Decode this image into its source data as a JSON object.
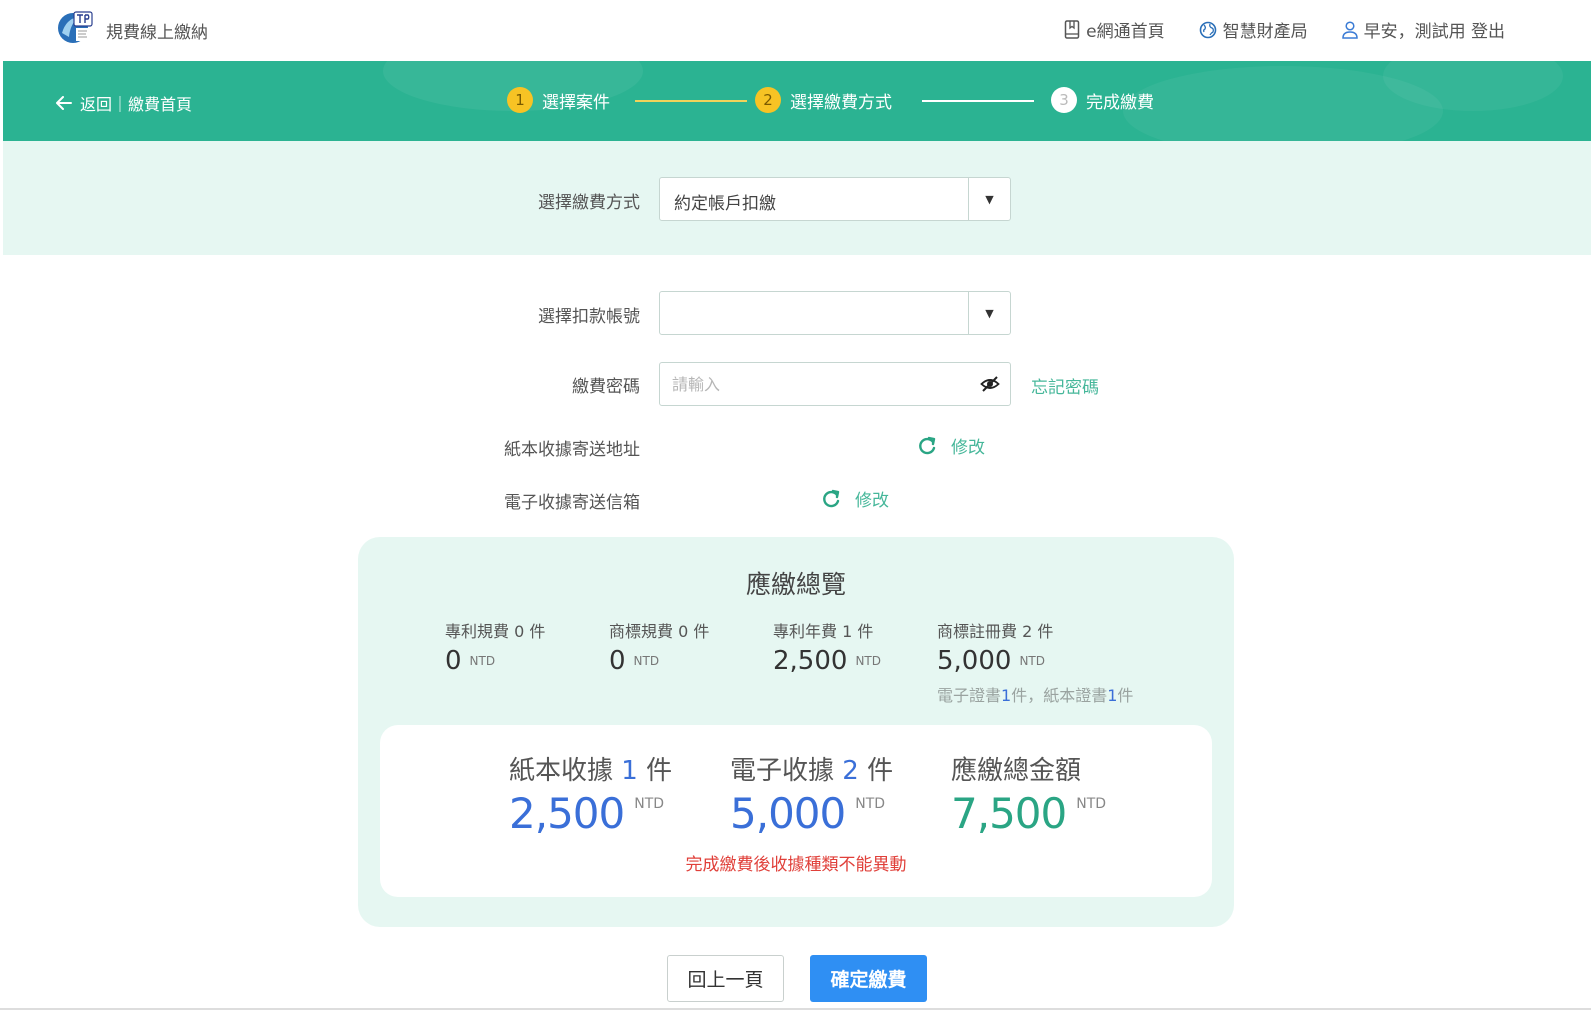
{
  "header": {
    "site_title": "規費線上繳納",
    "nav": [
      {
        "label": "e網通首頁",
        "icon": "book-icon"
      },
      {
        "label": "智慧財產局",
        "icon": "globe-icon"
      },
      {
        "label": "早安，測試用 登出",
        "icon": "user-icon"
      }
    ]
  },
  "stepper": {
    "back_label": "返回｜繳費首頁",
    "steps": [
      {
        "num": "1",
        "label": "選擇案件",
        "state": "done"
      },
      {
        "num": "2",
        "label": "選擇繳費方式",
        "state": "current"
      },
      {
        "num": "3",
        "label": "完成繳費",
        "state": "pending"
      }
    ]
  },
  "form": {
    "method_label": "選擇繳費方式",
    "method_value": "約定帳戶扣繳",
    "account_label": "選擇扣款帳號",
    "account_value": "",
    "password_label": "繳費密碼",
    "password_placeholder": "請輸入",
    "forgot_password": "忘記密碼",
    "paper_address_label": "紙本收據寄送地址",
    "email_label": "電子收據寄送信箱",
    "edit_label": "修改"
  },
  "summary": {
    "title": "應繳總覽",
    "fees": [
      {
        "caption": "專利規費 0 件",
        "amount": "0",
        "unit": "NTD"
      },
      {
        "caption": "商標規費 0 件",
        "amount": "0",
        "unit": "NTD"
      },
      {
        "caption": "專利年費 1 件",
        "amount": "2,500",
        "unit": "NTD"
      },
      {
        "caption": "商標註冊費 2 件",
        "amount": "5,000",
        "unit": "NTD",
        "note": {
          "p1": "電子證書",
          "n1": "1",
          "p2": "件，紙本證書",
          "n2": "1",
          "p3": "件"
        }
      }
    ],
    "totals": [
      {
        "pre": "紙本收據 ",
        "count": "1",
        "post": " 件",
        "amount": "2,500",
        "unit": "NTD"
      },
      {
        "pre": "電子收據 ",
        "count": "2",
        "post": " 件",
        "amount": "5,000",
        "unit": "NTD"
      },
      {
        "pre": "應繳總金額",
        "count": "",
        "post": "",
        "amount": "7,500",
        "unit": "NTD"
      }
    ],
    "warning": "完成繳費後收據種類不能異動"
  },
  "buttons": {
    "prev": "回上一頁",
    "confirm": "確定繳費"
  },
  "colors": {
    "brand_green": "#2bb392",
    "light_green": "#e6f7f2",
    "step_yellow": "#f7c324",
    "link_green": "#46b79a",
    "accent_blue": "#3a6fd8",
    "warn_red": "#e0403a",
    "button_blue": "#2f8ff3"
  }
}
